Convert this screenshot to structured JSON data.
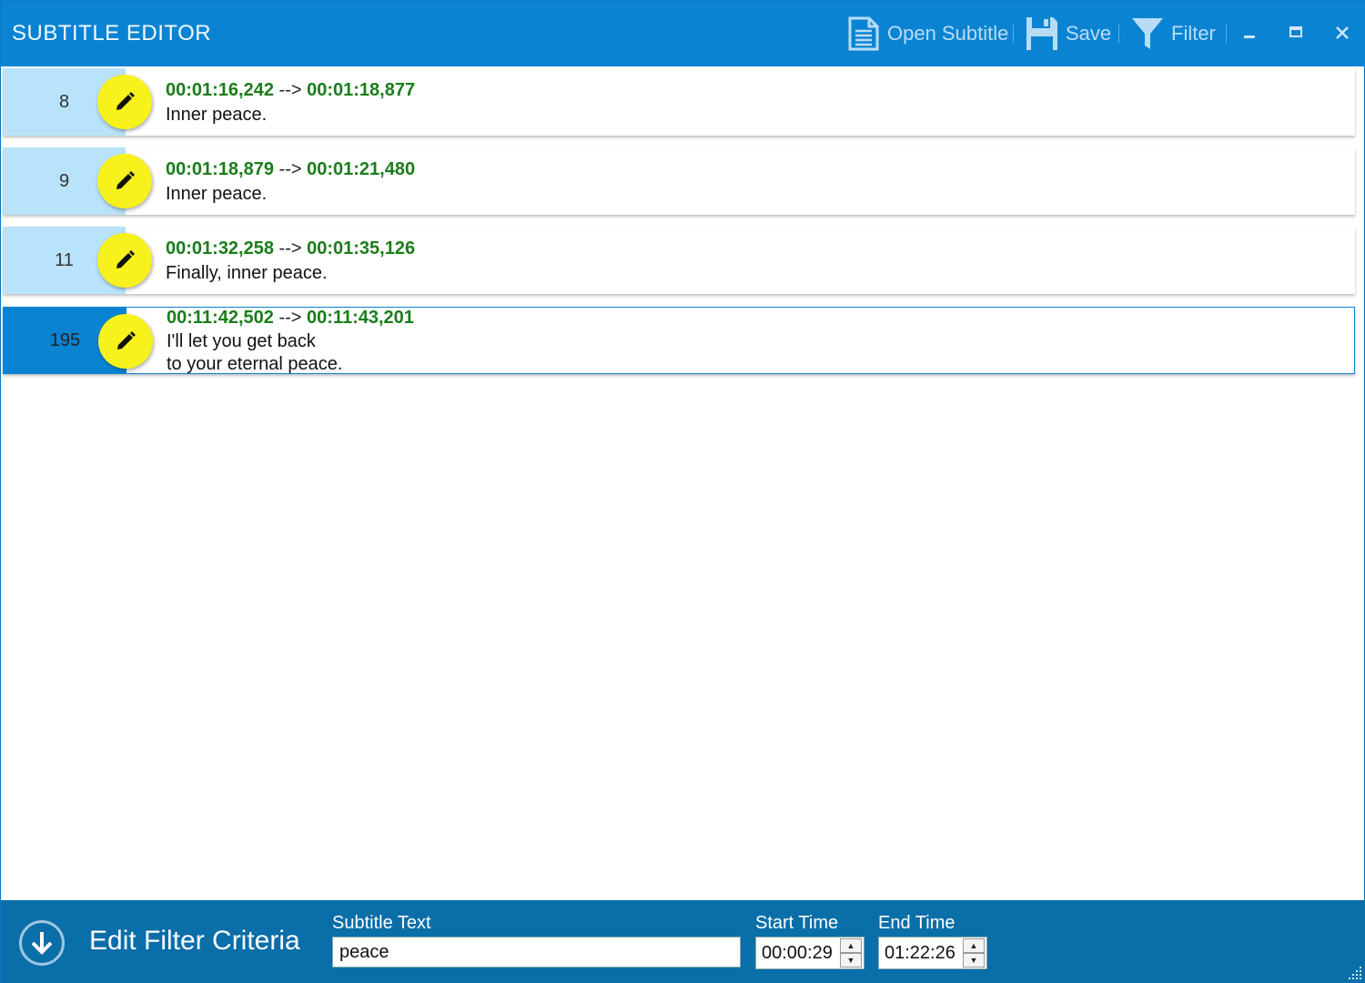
{
  "app": {
    "title": "SUBTITLE EDITOR"
  },
  "toolbar": {
    "open_label": "Open Subtitle",
    "save_label": "Save",
    "filter_label": "Filter"
  },
  "window_controls": {
    "minimize": "–",
    "maximize": "□",
    "close": "✕"
  },
  "subtitles": [
    {
      "number": "8",
      "start": "00:01:16,242",
      "arrow": "-->",
      "end": "00:01:18,877",
      "text": "Inner peace."
    },
    {
      "number": "9",
      "start": "00:01:18,879",
      "arrow": "-->",
      "end": "00:01:21,480",
      "text": "Inner peace."
    },
    {
      "number": "11",
      "start": "00:01:32,258",
      "arrow": "-->",
      "end": "00:01:35,126",
      "text": "Finally, inner peace."
    },
    {
      "number": "195",
      "start": "00:11:42,502",
      "arrow": "-->",
      "end": "00:11:43,201",
      "text": "I'll let you get back\nto your eternal peace.",
      "selected": true
    }
  ],
  "filter_panel": {
    "title": "Edit Filter Criteria",
    "subtitle_text_label": "Subtitle Text",
    "subtitle_text_value": "peace",
    "start_time_label": "Start Time",
    "start_time_value": "00:00:29",
    "end_time_label": "End Time",
    "end_time_value": "01:22:26"
  },
  "colors": {
    "titlebar": "#0a84d2",
    "row_number_bg": "#b9e3fb",
    "selected_number_bg": "#0a84d2",
    "edit_button": "#f7f21c",
    "timecode": "#1a7d1a",
    "bottombar": "#0a6ea8"
  },
  "icons": {
    "open": "document-icon",
    "save": "floppy-disk-icon",
    "filter": "funnel-icon",
    "edit": "pencil-icon",
    "collapse": "arrow-down-circle-icon"
  }
}
